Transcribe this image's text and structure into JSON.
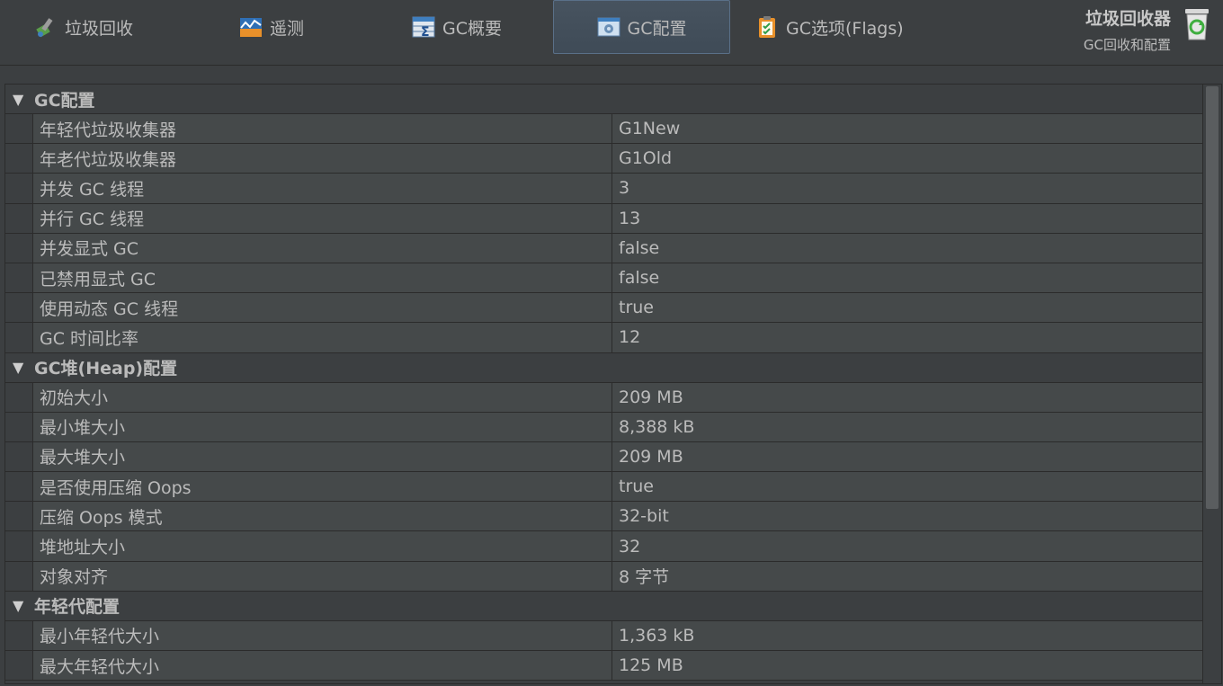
{
  "tabs": [
    {
      "label": "垃圾回收",
      "icon": "recycle-pen-icon"
    },
    {
      "label": "遥测",
      "icon": "chart-icon"
    },
    {
      "label": "GC概要",
      "icon": "sigma-table-icon"
    },
    {
      "label": "GC配置",
      "icon": "gear-window-icon",
      "active": true
    },
    {
      "label": "GC选项(Flags)",
      "icon": "clipboard-check-icon"
    }
  ],
  "header": {
    "title": "垃圾回收器",
    "subtitle": "GC回收和配置",
    "icon": "recycle-bin-icon"
  },
  "sections": [
    {
      "title": "GC配置",
      "rows": [
        {
          "name": "年轻代垃圾收集器",
          "value": "G1New"
        },
        {
          "name": "年老代垃圾收集器",
          "value": "G1Old"
        },
        {
          "name": "并发 GC 线程",
          "value": "3"
        },
        {
          "name": "并行 GC 线程",
          "value": "13"
        },
        {
          "name": "并发显式 GC",
          "value": "false"
        },
        {
          "name": "已禁用显式 GC",
          "value": "false"
        },
        {
          "name": "使用动态 GC 线程",
          "value": "true"
        },
        {
          "name": "GC 时间比率",
          "value": "12"
        }
      ]
    },
    {
      "title": "GC堆(Heap)配置",
      "rows": [
        {
          "name": "初始大小",
          "value": "209 MB"
        },
        {
          "name": "最小堆大小",
          "value": "8,388 kB"
        },
        {
          "name": "最大堆大小",
          "value": "209 MB"
        },
        {
          "name": "是否使用压缩 Oops",
          "value": "true"
        },
        {
          "name": "压缩 Oops 模式",
          "value": "32-bit"
        },
        {
          "name": "堆地址大小",
          "value": "32"
        },
        {
          "name": "对象对齐",
          "value": "8 字节"
        }
      ]
    },
    {
      "title": "年轻代配置",
      "rows": [
        {
          "name": "最小年轻代大小",
          "value": "1,363 kB"
        },
        {
          "name": "最大年轻代大小",
          "value": "125 MB"
        }
      ]
    }
  ],
  "colors": {
    "background": "#3c3f41",
    "row": "#45494a",
    "grid": "#2b2b2b",
    "text": "#bbbbbb",
    "active_tab": "#47535f"
  }
}
